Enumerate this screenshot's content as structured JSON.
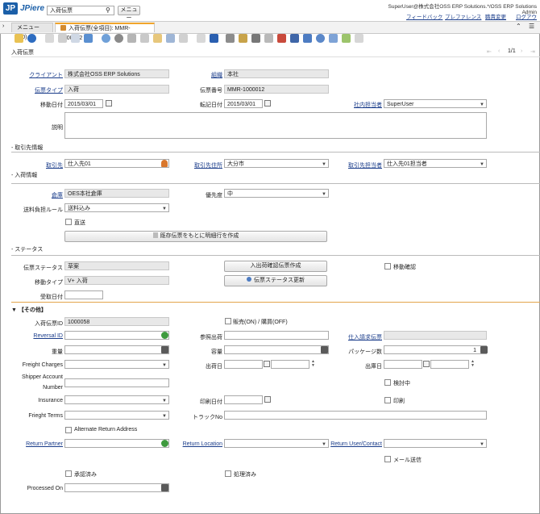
{
  "header": {
    "logo_mark": "JP",
    "logo_text": "JPiere",
    "search_value": "入荷伝票",
    "menu_button": "メニュー",
    "user_info": "SuperUser@株式会社OSS ERP Solutions.*/OSS ERP Solutions Admin",
    "links": [
      "フィードバック",
      "プレファレンス",
      "職責変更",
      "ログアウト"
    ]
  },
  "tabs": [
    {
      "label": "メニュー (40)"
    },
    {
      "label": "入荷伝票(全項目): MMR-1000012"
    }
  ],
  "page_title": "入荷伝票",
  "pager": "1/1",
  "fields": {
    "client_label": "クライアント",
    "client_value": "株式会社OSS ERP Solutions",
    "org_label": "組織",
    "org_value": "本社",
    "doctype_label": "伝票タイプ",
    "doctype_value": "入荷",
    "docno_label": "伝票番号",
    "docno_value": "MMR-1000012",
    "movedate_label": "移動日付",
    "movedate_value": "2015/03/01",
    "acctdate_label": "転記日付",
    "acctdate_value": "2015/03/01",
    "rep_label": "社内担当者",
    "rep_value": "SuperUser",
    "desc_label": "説明"
  },
  "sec_partner": {
    "title": "取引先情報",
    "bp_label": "取引先",
    "bp_value": "仕入先01",
    "loc_label": "取引先住所",
    "loc_value": "大分市",
    "contact_label": "取引先担当者",
    "contact_value": "仕入先01担当者"
  },
  "sec_receipt": {
    "title": "入荷情報",
    "wh_label": "倉庫",
    "wh_value": "OES本社倉庫",
    "prio_label": "優先度",
    "prio_value": "中",
    "freight_label": "送料負担ルール",
    "freight_value": "送料込み",
    "direct_label": "直送",
    "create_lines": "既存伝票をもとに明細行を作成"
  },
  "sec_status": {
    "title": "ステータス",
    "status_label": "伝票ステータス",
    "status_value": "草案",
    "confirm_button": "入出荷確認伝票作成",
    "inout_label": "移動確認",
    "movetype_label": "移動タイプ",
    "movetype_value": "V+ 入荷",
    "update_button": "伝票ステータス更新",
    "recvdate_label": "受取日付"
  },
  "sec_other": {
    "title": "【その他】",
    "receipt_id_label": "入荷伝票ID",
    "receipt_id_value": "1000058",
    "sotrx_label": "販売(ON) / 購買(OFF)",
    "reversal_label": "Reversal ID",
    "poref_label": "参照出荷",
    "invoice_label": "仕入請求伝票",
    "weight_label": "重量",
    "volume_label": "容量",
    "packages_label": "パッケージ数",
    "packages_value": "1",
    "fcharges_label": "Freight Charges",
    "shipdate_label": "出荷日",
    "pickdate_label": "出庫日",
    "shipacct_label1": "Shipper Account",
    "shipacct_label2": "Number",
    "intransit_label": "検討中",
    "insurance_label": "Insurance",
    "printdate_label": "印刷日付",
    "printed_label": "印刷",
    "fterms_label": "Frieght Terms",
    "tracking_label": "トラックNo",
    "altaddr_label": "Alternate Return Address",
    "rpartner_label": "Return Partner",
    "rlocation_label": "Return Location",
    "ruser_label": "Return User/Contact",
    "mailsent_label": "メール送信",
    "approved_label": "承認済み",
    "processed_label": "処理済み",
    "processedon_label": "Processed On"
  }
}
